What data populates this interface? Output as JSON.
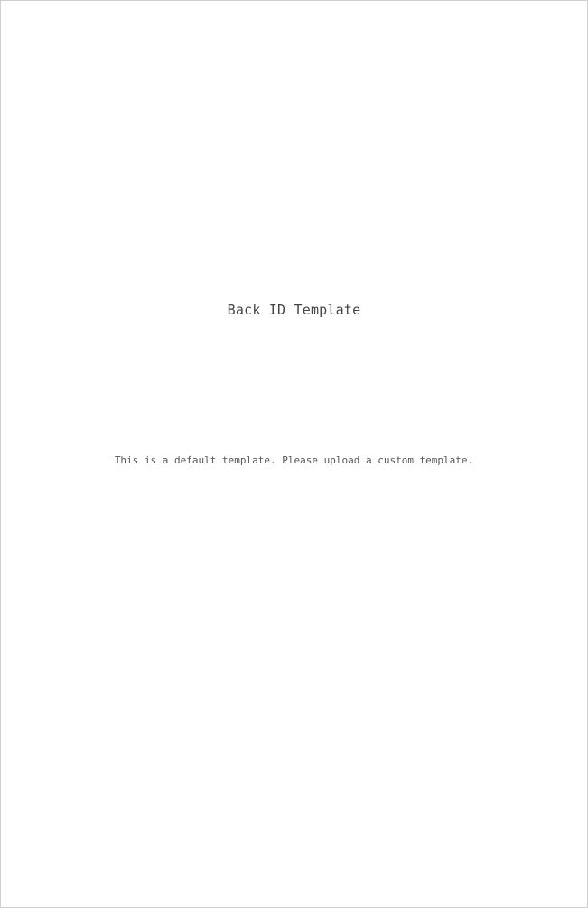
{
  "template": {
    "title": "Back ID Template",
    "note": "This is a default template. Please upload a custom template."
  }
}
